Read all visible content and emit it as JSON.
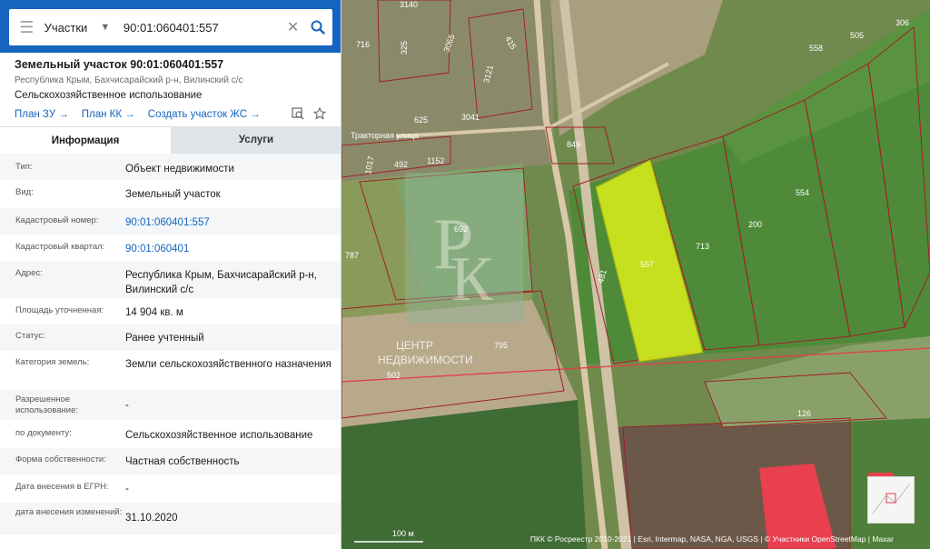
{
  "search": {
    "layer": "Участки",
    "value": "90:01:060401:557"
  },
  "object": {
    "title": "Земельный участок 90:01:060401:557",
    "address_short": "Республика Крым, Бахчисарайский р-н, Вилинский с/с",
    "usage": "Сельскохозяйственное использование",
    "links": [
      "План ЗУ →",
      "План КК →",
      "Создать участок ЖС →"
    ]
  },
  "tabs": [
    "Информация",
    "Услуги"
  ],
  "rows": [
    {
      "k": "Тип:",
      "v": "Объект недвижимости"
    },
    {
      "k": "Вид:",
      "v": "Земельный участок"
    },
    {
      "k": "Кадастровый номер:",
      "v": "90:01:060401:557"
    },
    {
      "k": "Кадастровый квартал:",
      "v": "90:01:060401"
    },
    {
      "k": "Адрес:",
      "v": "Республика Крым, Бахчисарайский р-н, Вилинский с/с"
    },
    {
      "k": "Площадь уточненная:",
      "v": "14 904 кв. м"
    },
    {
      "k": "Статус:",
      "v": "Ранее учтенный"
    },
    {
      "k": "Категория земель:",
      "v": "Земли сельскохозяйственного назначения"
    },
    {
      "k": "Разрешенное использование:",
      "v": "-"
    },
    {
      "k": "по документу:",
      "v": "Сельскохозяйственное использование"
    },
    {
      "k": "Форма собственности:",
      "v": "Частная собственность"
    },
    {
      "k": "Дата внесения в ЕГРН:",
      "v": "-"
    },
    {
      "k": "дата внесения изменений:",
      "v": "31.10.2020"
    }
  ],
  "map": {
    "street": "Тракторная улица",
    "watermark_text": "ЦЕНТР\nНЕДВИЖИМОСТИ",
    "scale": "100 м",
    "attribution": "ПКК © Росреестр 2010-2021 | Esri, Intermap, NASA, NGA, USGS | © Участники OpenStreetMap | Maxar",
    "parcels": [
      "557",
      "713",
      "481",
      "200",
      "554",
      "558",
      "505",
      "306",
      "126",
      "795",
      "502",
      "787",
      "692",
      "849",
      "492",
      "1152",
      "1017",
      "625",
      "3041",
      "3121",
      "415",
      "3065",
      "325",
      "716",
      "3140"
    ]
  },
  "colors": {
    "header_blue": "#1565c0",
    "selected_parcel": "#d4e81c"
  }
}
